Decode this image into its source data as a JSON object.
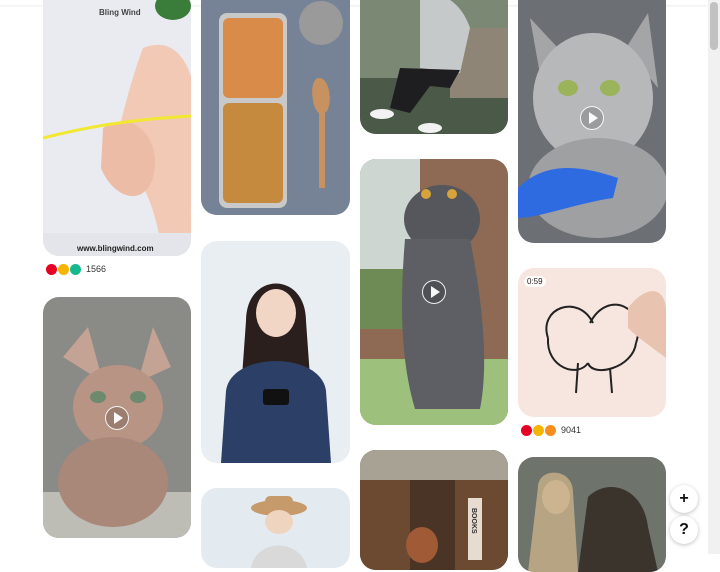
{
  "pins": [
    {
      "id": "yarn",
      "watermark_top": "Bling Wind",
      "watermark_bottom": "www.blingwind.com",
      "reactions": [
        "heart-icon",
        "smile-icon",
        "star-icon"
      ],
      "count": "1566"
    },
    {
      "id": "bento"
    },
    {
      "id": "woman-bench"
    },
    {
      "id": "silver-cat",
      "video": true
    },
    {
      "id": "sphynx",
      "video": true
    },
    {
      "id": "woman-camera"
    },
    {
      "id": "scottish-fold",
      "video": true
    },
    {
      "id": "drawing",
      "duration": "0:59",
      "reactions": [
        "heart-icon",
        "smile-icon",
        "wow-icon"
      ],
      "count": "9041"
    },
    {
      "id": "woman-hat"
    },
    {
      "id": "bookshelf",
      "sign": "BOOKS"
    },
    {
      "id": "woman-owl"
    }
  ],
  "fab": {
    "add_label": "+",
    "help_label": "?"
  },
  "colors": {
    "reaction_heart": "#e60023",
    "reaction_smile": "#f5b400",
    "reaction_star": "#17b890",
    "reaction_wow": "#f78c1f"
  }
}
